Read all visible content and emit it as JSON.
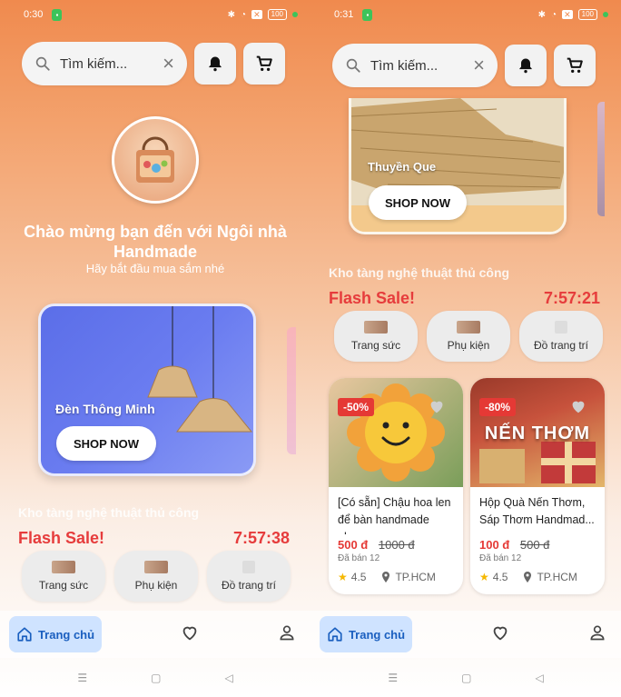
{
  "left": {
    "status": {
      "time": "0:30",
      "battery": "100"
    },
    "search": {
      "placeholder": "Tìm kiếm..."
    },
    "welcome": {
      "title": "Chào mừng bạn đến với Ngôi nhà Handmade",
      "subtitle": "Hãy bắt đầu mua sắm nhé"
    },
    "banner": {
      "title": "Đèn Thông Minh",
      "button": "SHOP NOW"
    },
    "section_title": "Kho tàng nghệ thuật thủ công",
    "flash_sale": "Flash Sale!",
    "timer": "7:57:38",
    "categories": [
      "Trang sức",
      "Phụ kiện",
      "Đồ trang trí"
    ],
    "nav": {
      "home": "Trang chủ"
    }
  },
  "right": {
    "status": {
      "time": "0:31",
      "battery": "100"
    },
    "search": {
      "placeholder": "Tìm kiếm..."
    },
    "banner": {
      "title": "Thuyền Que",
      "button": "SHOP NOW"
    },
    "section_title": "Kho tàng nghệ thuật thủ công",
    "flash_sale": "Flash Sale!",
    "timer": "7:57:21",
    "categories": [
      "Trang sức",
      "Phụ kiện",
      "Đồ trang trí"
    ],
    "products": [
      {
        "discount": "-50%",
        "name": "[Có sẵn] Chậu hoa len để bàn handmade nh...",
        "price": "500 đ",
        "old_price": "1000 đ",
        "sold": "Đã bán 12",
        "rating": "4.5",
        "location": "TP.HCM"
      },
      {
        "discount": "-80%",
        "image_text": "NẾN THƠM",
        "name": "Hộp Quà Nến Thơm, Sáp Thơm Handmad...",
        "price": "100 đ",
        "old_price": "500 đ",
        "sold": "Đã bán 12",
        "rating": "4.5",
        "location": "TP.HCM"
      }
    ],
    "nav": {
      "home": "Trang chủ"
    }
  },
  "colors": {
    "accent": "#e63c3c",
    "home_active_bg": "#cfe3ff",
    "home_active_text": "#1a5fbf",
    "gradient_top": "#f08a4e"
  }
}
